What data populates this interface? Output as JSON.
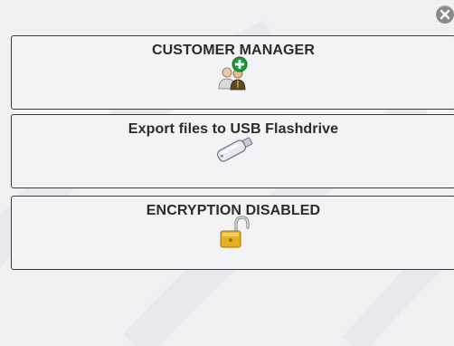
{
  "dialog": {
    "close_icon": "close-icon",
    "buttons": [
      {
        "label": "CUSTOMER MANAGER",
        "icon": "customer-manager-icon"
      },
      {
        "label": "Export files to USB Flashdrive",
        "icon": "usb-flashdrive-icon"
      },
      {
        "label": "ENCRYPTION DISABLED",
        "icon": "unlocked-padlock-icon"
      }
    ]
  },
  "colors": {
    "background": "#f1f1f3",
    "border": "#3a3a3a",
    "text": "#2b2b2b",
    "close_button": "#8a8a8a",
    "plus_badge": "#1f9a3a",
    "padlock": "#e3b21f"
  }
}
